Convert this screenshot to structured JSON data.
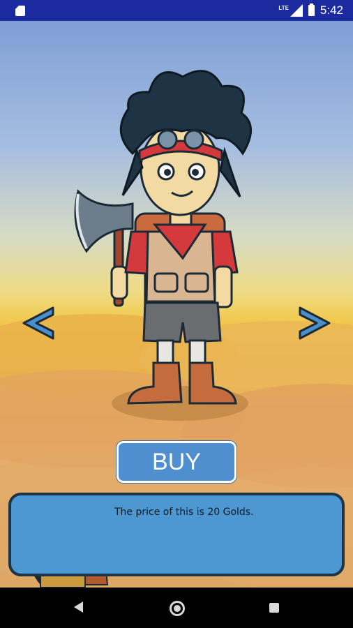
{
  "status_bar": {
    "network": "LTE",
    "time": "5:42",
    "icons": [
      "sd-card-icon",
      "lte-signal-icon",
      "battery-charging-icon"
    ]
  },
  "shop": {
    "buy_label": "BUY",
    "prev_arrow": "<",
    "next_arrow": ">"
  },
  "dialog": {
    "message": "The price of this is 20 Golds."
  },
  "nav_bar": {
    "icons": [
      "back-icon",
      "home-icon",
      "recents-icon"
    ]
  },
  "colors": {
    "status_bar": "#1b2a9e",
    "button_blue": "#4f8fcf",
    "dialog_blue": "#4d97d2",
    "arrow_blue": "#4a8fcc"
  }
}
